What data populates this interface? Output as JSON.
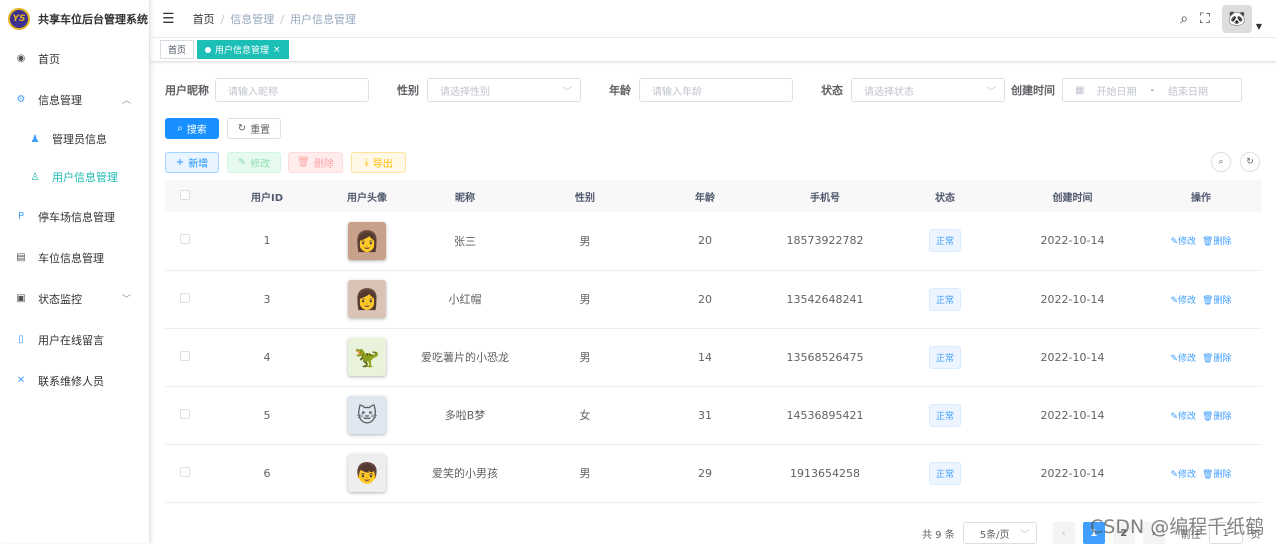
{
  "app": {
    "title": "共享车位后台管理系统",
    "logo_text": "YS"
  },
  "sidebar": {
    "items": [
      {
        "label": "首页"
      },
      {
        "label": "信息管理"
      },
      {
        "label": "管理员信息"
      },
      {
        "label": "用户信息管理"
      },
      {
        "label": "停车场信息管理"
      },
      {
        "label": "车位信息管理"
      },
      {
        "label": "状态监控"
      },
      {
        "label": "用户在线留言"
      },
      {
        "label": "联系维修人员"
      }
    ]
  },
  "breadcrumb": [
    "首页",
    "信息管理",
    "用户信息管理"
  ],
  "tags": [
    {
      "label": "首页"
    },
    {
      "label": "用户信息管理",
      "close": "×"
    }
  ],
  "form": {
    "nickname_label": "用户昵称",
    "nickname_placeholder": "请输入昵称",
    "gender_label": "性别",
    "gender_placeholder": "请选择性别",
    "age_label": "年龄",
    "age_placeholder": "请输入年龄",
    "status_label": "状态",
    "status_placeholder": "请选择状态",
    "created_label": "创建时间",
    "start_placeholder": "开始日期",
    "range_sep": "-",
    "end_placeholder": "结束日期"
  },
  "buttons": {
    "search": "搜索",
    "reset": "重置",
    "add": "新增",
    "edit": "修改",
    "delete": "删除",
    "export": "导出"
  },
  "table": {
    "columns": [
      "用户ID",
      "用户头像",
      "昵称",
      "性别",
      "年龄",
      "手机号",
      "状态",
      "创建时间",
      "操作"
    ],
    "rows": [
      {
        "id": "1",
        "avatar": "👩",
        "nickname": "张三",
        "gender": "男",
        "age": "20",
        "phone": "18573922782",
        "status": "正常",
        "created": "2022-10-14"
      },
      {
        "id": "3",
        "avatar": "👩",
        "nickname": "小红帽",
        "gender": "男",
        "age": "20",
        "phone": "13542648241",
        "status": "正常",
        "created": "2022-10-14"
      },
      {
        "id": "4",
        "avatar": "🦖",
        "nickname": "爱吃薯片的小恐龙",
        "gender": "男",
        "age": "14",
        "phone": "13568526475",
        "status": "正常",
        "created": "2022-10-14"
      },
      {
        "id": "5",
        "avatar": "🐱",
        "nickname": "多啦B梦",
        "gender": "女",
        "age": "31",
        "phone": "14536895421",
        "status": "正常",
        "created": "2022-10-14"
      },
      {
        "id": "6",
        "avatar": "👦",
        "nickname": "爱笑的小男孩",
        "gender": "男",
        "age": "29",
        "phone": "1913654258",
        "status": "正常",
        "created": "2022-10-14"
      }
    ],
    "op_edit": "修改",
    "op_delete": "删除"
  },
  "pagination": {
    "total": "共 9 条",
    "page_size": "5条/页",
    "pages": [
      "1",
      "2"
    ],
    "current": "1",
    "goto_label": "前往",
    "goto_value": "1",
    "page_suffix": "页"
  },
  "watermark": "CSDN @编程千纸鹤"
}
